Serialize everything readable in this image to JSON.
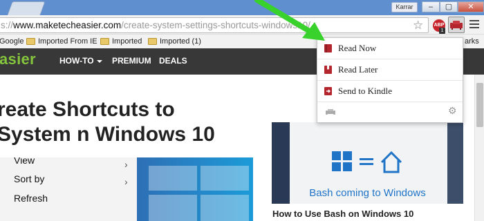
{
  "browser": {
    "user_label": "Karrar",
    "win_min": "–",
    "win_max": "▢",
    "win_close": "✕",
    "url_scheme": "s://",
    "url_host": "www.maketecheasier.com",
    "url_path": "/create-system-settings-shortcuts-windows10/",
    "star_icon": "☆",
    "abp_label": "ABP",
    "abp_badge": "1",
    "bookmarks": [
      "Google",
      "Imported From IE",
      "Imported",
      "Imported (1)"
    ],
    "bookmarks_more": "arks"
  },
  "site": {
    "logo": "asier",
    "nav": {
      "howto": "HOW-TO",
      "premium": "PREMIUM",
      "deals": "DEALS"
    }
  },
  "article": {
    "title": "reate Shortcuts to System n Windows 10",
    "menu_items": [
      "View",
      "Sort by",
      "Refresh"
    ]
  },
  "sidebar": {
    "thumb_text": "Bash coming to Windows",
    "caption": "How to Use Bash on Windows 10"
  },
  "popup": {
    "items": [
      "Read Now",
      "Read Later",
      "Send to Kindle"
    ],
    "gear_icon": "⚙"
  },
  "colors": {
    "accent_green": "#84c53c",
    "pocket_red": "#b3262d",
    "arrow_green": "#39d12b"
  }
}
